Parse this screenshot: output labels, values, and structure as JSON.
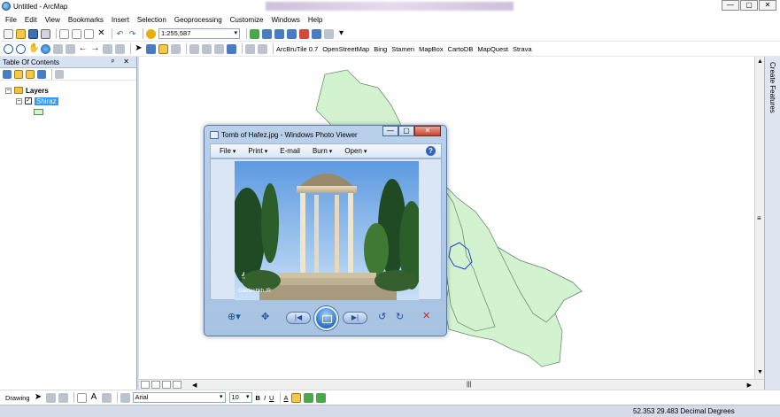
{
  "window": {
    "title": "Untitled - ArcMap",
    "blurred_caption": "Book Hawr-Ol-ahi (Compatibility Mode) - Word Product Activation Failed"
  },
  "menu": [
    "File",
    "Edit",
    "View",
    "Bookmarks",
    "Insert",
    "Selection",
    "Geoprocessing",
    "Customize",
    "Windows",
    "Help"
  ],
  "toolbar1": {
    "scale": "1:255,587"
  },
  "toolbar2": {
    "arcbrutile": "ArcBruTile 0.7",
    "providers": [
      "OpenStreetMap",
      "Bing",
      "Stamen",
      "MapBox",
      "CartoDB",
      "MapQuest",
      "Strava"
    ]
  },
  "toc": {
    "title": "Table Of Contents",
    "header_buttons": "ᵖ ✕",
    "root": "Layers",
    "layer": "Shiraz",
    "layer_checked": "✓",
    "expand_root": "−",
    "expand_layer": "−"
  },
  "side_dock": {
    "label": "Create Features"
  },
  "photo_viewer": {
    "title": "Tomb of Hafez.jpg - Windows Photo Viewer",
    "menu": [
      "File",
      "Print",
      "E-mail",
      "Burn",
      "Open"
    ],
    "help": "?",
    "watermark": "Gardeshkh.IR",
    "title_buttons": [
      "—",
      "▢",
      "✕"
    ]
  },
  "drawing": {
    "drawing_label": "Drawing",
    "font": "Arial",
    "size": "10",
    "bold": "B",
    "italic": "I",
    "underline": "U",
    "color_a": "A"
  },
  "status": {
    "coordinates": "52.353  29.483 Decimal Degrees"
  },
  "colors": {
    "polygon_fill": "#d3f2d0",
    "polygon_stroke": "#6f8f6f",
    "highlight_stroke": "#1f3fd8",
    "selection": "#3399ff"
  }
}
